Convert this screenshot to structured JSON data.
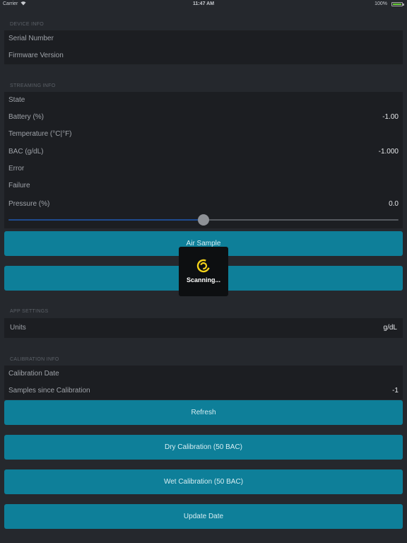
{
  "status_bar": {
    "carrier": "Carrier",
    "time": "11:47 AM",
    "battery": "100%"
  },
  "device_info": {
    "header": "DEVICE INFO",
    "rows": [
      {
        "label": "Serial Number",
        "value": ""
      },
      {
        "label": "Firmware Version",
        "value": ""
      }
    ]
  },
  "streaming_info": {
    "header": "STREAMING INFO",
    "rows": [
      {
        "label": "State",
        "value": ""
      },
      {
        "label": "Battery (%)",
        "value": "-1.00"
      },
      {
        "label": "Temperature (°C|°F)",
        "value": ""
      },
      {
        "label": "BAC (g/dL)",
        "value": "-1.000"
      },
      {
        "label": "Error",
        "value": ""
      },
      {
        "label": "Failure",
        "value": ""
      },
      {
        "label": "Pressure (%)",
        "value": "0.0"
      }
    ],
    "pressure_slider_fraction": 0.5
  },
  "buttons": {
    "air_sample": "Air Sample",
    "second": "",
    "refresh": "Refresh",
    "dry_calibration": "Dry Calibration (50 BAC)",
    "wet_calibration": "Wet Calibration (50 BAC)",
    "update_date": "Update Date"
  },
  "hud": {
    "text": "Scanning...",
    "icon": "spinner-logo-icon",
    "icon_color": "#f5d31a"
  },
  "app_settings": {
    "header": "APP SETTINGS",
    "units_label": "Units",
    "units_value": "g/dL"
  },
  "calibration_info": {
    "header": "CALIBRATION INFO",
    "rows": [
      {
        "label": "Calibration Date",
        "value": ""
      },
      {
        "label": "Samples since Calibration",
        "value": "-1"
      }
    ]
  },
  "colors": {
    "background": "#25282d",
    "cell": "#1c1e22",
    "button": "#0e7f99",
    "slider_fill": "#1f4b8f",
    "battery": "#6ad03a"
  }
}
